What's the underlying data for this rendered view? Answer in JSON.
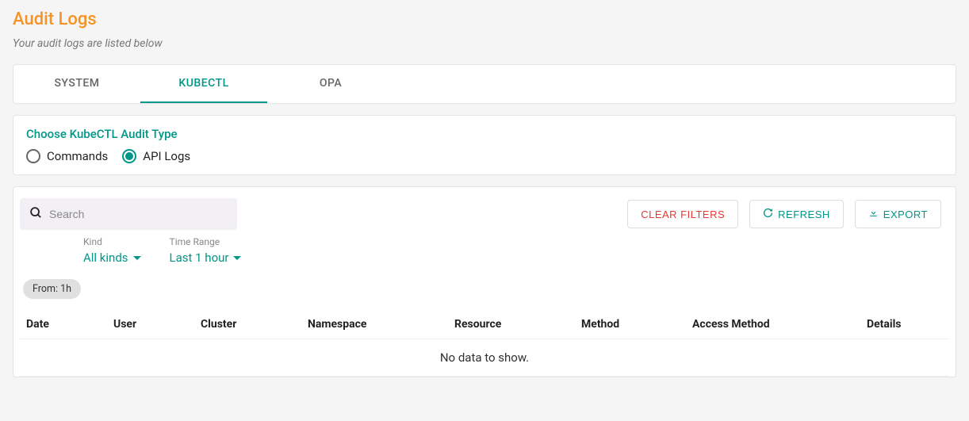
{
  "page": {
    "title": "Audit Logs",
    "subtitle": "Your audit logs are listed below"
  },
  "tabs": [
    {
      "label": "SYSTEM",
      "active": false
    },
    {
      "label": "KUBECTL",
      "active": true
    },
    {
      "label": "OPA",
      "active": false
    }
  ],
  "audit_type": {
    "title": "Choose KubeCTL Audit Type",
    "options": [
      {
        "label": "Commands",
        "selected": false
      },
      {
        "label": "API Logs",
        "selected": true
      }
    ]
  },
  "filters": {
    "search_placeholder": "Search",
    "clear_label": "CLEAR FILTERS",
    "refresh_label": "REFRESH",
    "export_label": "EXPORT",
    "kind": {
      "label": "Kind",
      "value": "All kinds"
    },
    "time_range": {
      "label": "Time Range",
      "value": "Last 1 hour"
    },
    "chip": "From: 1h"
  },
  "table": {
    "columns": [
      "Date",
      "User",
      "Cluster",
      "Namespace",
      "Resource",
      "Method",
      "Access Method",
      "Details"
    ],
    "empty_message": "No data to show."
  }
}
